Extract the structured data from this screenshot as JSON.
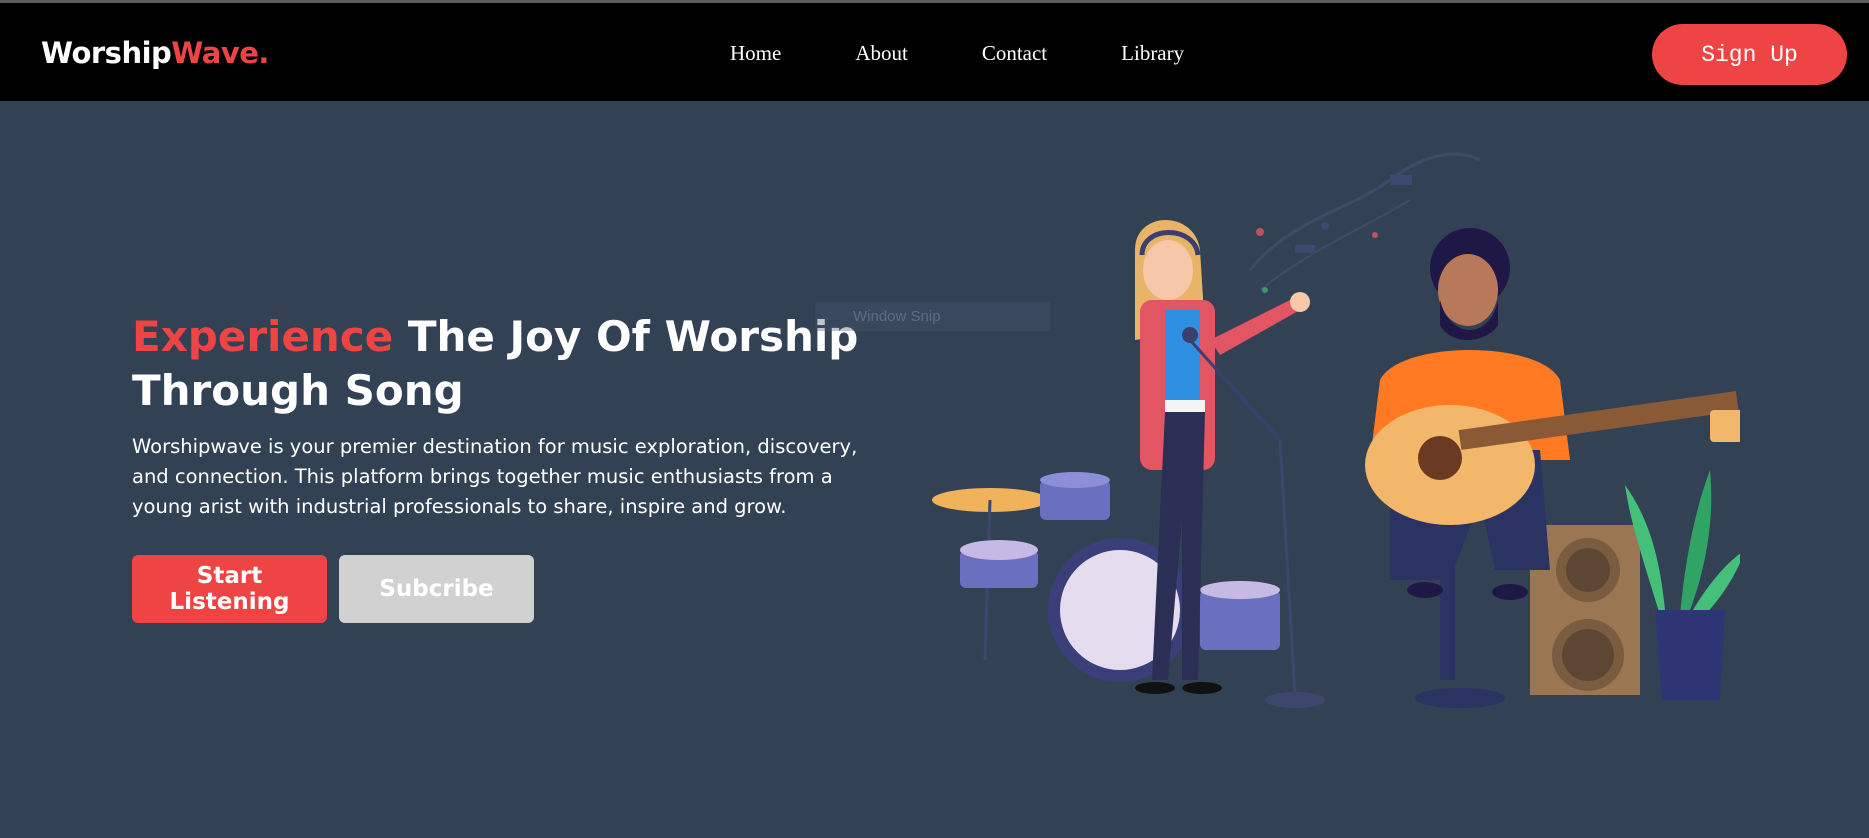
{
  "brand": {
    "name_part1": "Worship",
    "name_part2": "Wave."
  },
  "nav": {
    "items": [
      {
        "label": "Home"
      },
      {
        "label": "About"
      },
      {
        "label": "Contact"
      },
      {
        "label": "Library"
      }
    ]
  },
  "header": {
    "signup_label": "Sign Up"
  },
  "hero": {
    "title_accent": "Experience",
    "title_rest": " The Joy Of Worship Through Song",
    "description": "Worshipwave is your premier destination for music exploration, discovery, and connection. This platform brings together music enthusiasts from a young arist with industrial professionals to share, inspire and grow.",
    "primary_button": "Start Listening",
    "secondary_button": "Subcribe"
  },
  "overlay": {
    "ghost_text": "Window Snip"
  },
  "colors": {
    "accent": "#ef4444",
    "background": "#334155",
    "header": "#000000",
    "secondary_button": "#d1d1d1"
  },
  "illustration": {
    "name": "band-illustration",
    "subjects": [
      "singer-with-microphone",
      "guitarist",
      "drum-kit",
      "speaker",
      "plant",
      "music-notes"
    ]
  }
}
